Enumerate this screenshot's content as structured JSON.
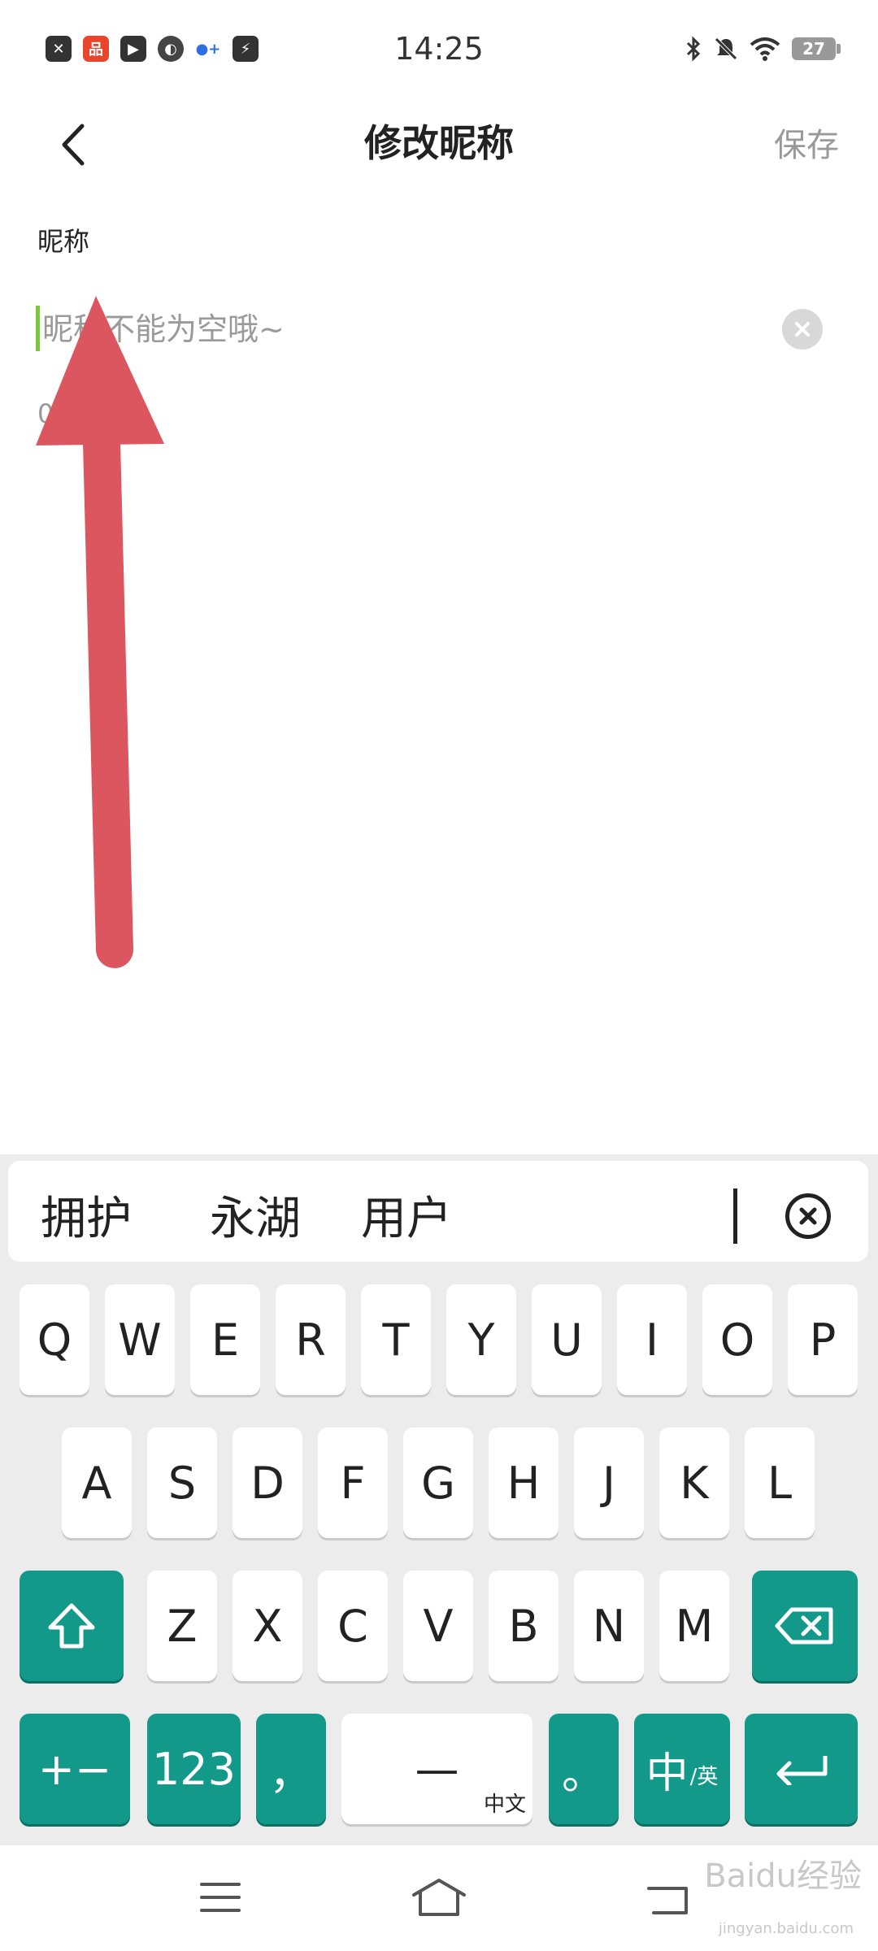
{
  "status_bar": {
    "time": "14:25",
    "battery": "27",
    "left_icons": [
      "close-app-icon",
      "shop-app-icon",
      "video-app-icon",
      "browser-app-icon",
      "dots-app-icon",
      "flash-app-icon"
    ],
    "right_icons": [
      "bluetooth-icon",
      "mute-icon",
      "wifi-icon",
      "battery-icon"
    ]
  },
  "header": {
    "title": "修改昵称",
    "save_label": "保存"
  },
  "form": {
    "label": "昵称",
    "input_value": "",
    "placeholder": "昵称不能为空哦~",
    "char_count": "0"
  },
  "keyboard": {
    "candidates": [
      "拥护",
      "永湖",
      "用户"
    ],
    "row1": [
      "Q",
      "W",
      "E",
      "R",
      "T",
      "Y",
      "U",
      "I",
      "O",
      "P"
    ],
    "row2": [
      "A",
      "S",
      "D",
      "F",
      "G",
      "H",
      "J",
      "K",
      "L"
    ],
    "row3": [
      "Z",
      "X",
      "C",
      "V",
      "B",
      "N",
      "M"
    ],
    "symbols_label": "+−",
    "numbers_label": "123",
    "comma_label": "，",
    "space_label": "—",
    "space_sub": "中文",
    "period_label": "。",
    "lang_main": "中",
    "lang_sub": "/英",
    "accent_color": "#13998a"
  },
  "watermark": {
    "text": "Baidu经验",
    "sub": "jingyan.baidu.com"
  }
}
